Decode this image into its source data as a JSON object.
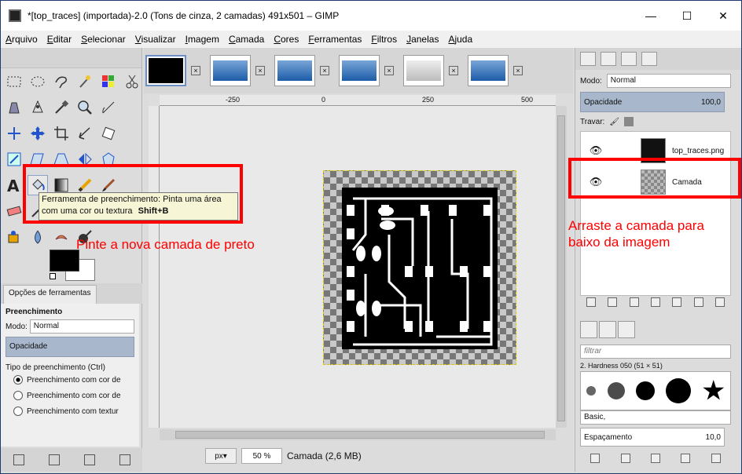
{
  "window": {
    "title": "*[top_traces] (importada)-2.0 (Tons de cinza, 2 camadas) 491x501 – GIMP",
    "minimize": "—",
    "maximize": "☐",
    "close": "✕"
  },
  "menu": [
    "Arquivo",
    "Editar",
    "Selecionar",
    "Visualizar",
    "Imagem",
    "Camada",
    "Cores",
    "Ferramentas",
    "Filtros",
    "Janelas",
    "Ajuda"
  ],
  "tooltip": {
    "text": "Ferramenta de preenchimento: Pinta uma área com uma cor ou textura",
    "shortcut": "Shift+B"
  },
  "tool_options": {
    "tab_label": "Opções de ferramentas",
    "section_title": "Preenchimento",
    "mode_label": "Modo:",
    "mode_value": "Normal",
    "opacity_label": "Opacidade",
    "fill_type_label": "Tipo de preenchimento (Ctrl)",
    "fill_options": [
      "Preenchimento com cor de",
      "Preenchimento com cor de",
      "Preenchimento com textur"
    ],
    "selected_fill_index": 0
  },
  "canvas": {
    "ruler_ticks": [
      "-250",
      "0",
      "250",
      "500"
    ],
    "unit": "px",
    "zoom": "50 %",
    "status": "Camada (2,6 MB)"
  },
  "layers_panel": {
    "mode_label": "Modo:",
    "mode_value": "Normal",
    "opacity_label": "Opacidade",
    "opacity_value": "100,0",
    "lock_label": "Travar:",
    "layers": [
      {
        "name": "top_traces.png",
        "visible": true
      },
      {
        "name": "Camada",
        "visible": true
      }
    ]
  },
  "brushes_panel": {
    "filter_placeholder": "filtrar",
    "brush_name": "2. Hardness 050 (51 × 51)",
    "preset": "Basic,",
    "spacing_label": "Espaçamento",
    "spacing_value": "10,0"
  },
  "annotations": {
    "left": "Pinte a nova camada de preto",
    "right": "Arraste a camada para baixo da imagem"
  },
  "colors": {
    "foreground": "#000000",
    "background": "#ffffff",
    "annotation": "#ff0000"
  }
}
